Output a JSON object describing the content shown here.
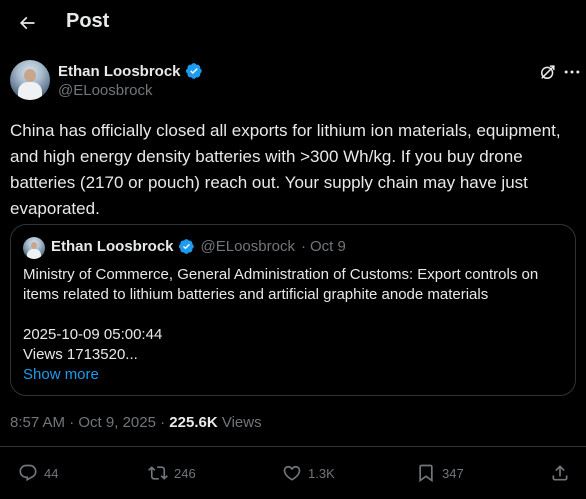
{
  "header": {
    "title": "Post"
  },
  "author": {
    "name": "Ethan Loosbrock",
    "handle": "@ELoosbrock",
    "verified_color": "#1d9bf0"
  },
  "tweet": {
    "text": "China has officially closed all exports for lithium ion materials, equipment, and high energy density batteries with >300 Wh/kg. If you buy drone batteries (2170 or pouch) reach out. Your supply chain may have just evaporated."
  },
  "quote": {
    "name": "Ethan Loosbrock",
    "handle": "@ELoosbrock",
    "date": "Oct 9",
    "line1": "Ministry of Commerce, General Administration of Customs: Export controls on",
    "line2": "items related to lithium batteries and artificial graphite anode materials",
    "line3": "2025-10-09 05:00:44",
    "line4": "Views 1713520...",
    "show_more": "Show more"
  },
  "meta": {
    "time": "8:57 AM",
    "date": "Oct 9, 2025",
    "views_count": "225.6K",
    "views_label": "Views"
  },
  "actions": {
    "replies": "44",
    "reposts": "246",
    "likes": "1.3K",
    "bookmarks": "347"
  },
  "colors": {
    "background": "#000000",
    "text": "#e7e9ea",
    "muted": "#71767b",
    "accent": "#1d9bf0",
    "border": "#2f3336"
  }
}
